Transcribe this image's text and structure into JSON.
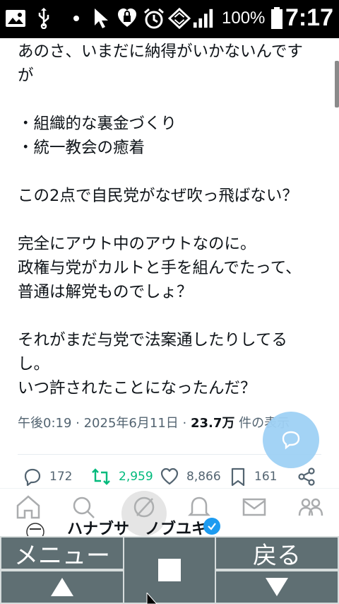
{
  "status_bar": {
    "battery_percent": "100%",
    "time": "7:17",
    "icons": [
      "image-icon",
      "usb-icon",
      "dot-icon",
      "cursor-icon",
      "heart-lock-icon",
      "alarm-icon",
      "data-arrows-icon",
      "signal-icon",
      "battery-icon"
    ]
  },
  "tweet": {
    "lines": [
      "あのさ、いまだに納得がいかないんです",
      "が",
      "",
      "・組織的な裏金づくり",
      "・統一教会の癒着",
      "",
      "この2点で自民党がなぜ吹っ飛ばない？",
      "",
      "完全にアウト中のアウトなのに。",
      "政権与党がカルトと手を組んでたって、",
      "普通は解党ものでしょ？",
      "",
      "それがまだ与党で法案通したりしてる",
      "し。",
      "いつ許されたことになったんだ？"
    ],
    "time": "午後0:19",
    "date": "2025年6月11日",
    "views": "23.7万",
    "views_label": "件の表示"
  },
  "actions": {
    "replies": "172",
    "retweets": "2,959",
    "likes": "8,866",
    "bookmarks": "161"
  },
  "colors": {
    "retweet": "#00ba7c",
    "accent": "#1d9bf0",
    "muted": "#536471"
  },
  "reply_user": {
    "name": "ハナブサ　ノブユキ"
  },
  "soft_keys": {
    "menu": "メニュー",
    "back": "戻る"
  }
}
